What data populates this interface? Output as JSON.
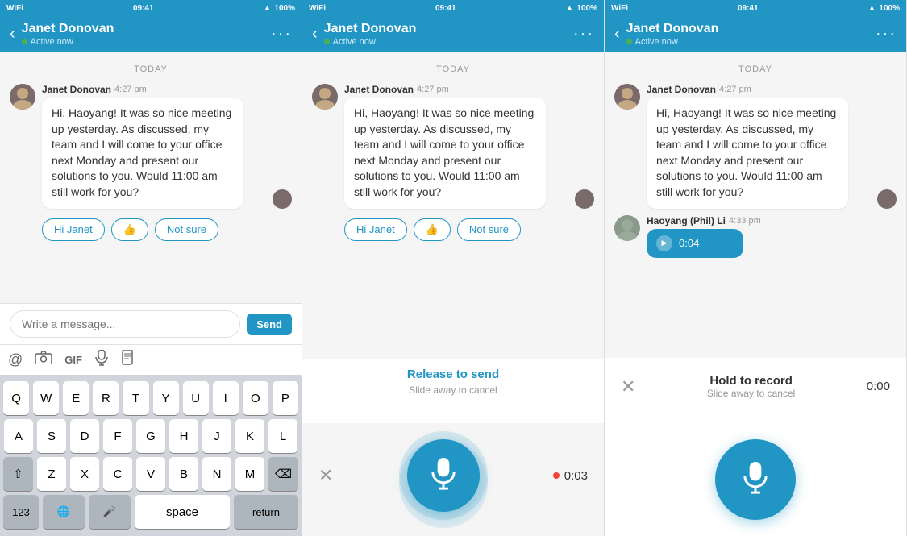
{
  "colors": {
    "primary": "#2196c4",
    "active_green": "#4caf50",
    "bg_light": "#f5f5f5",
    "text_dark": "#333",
    "text_mid": "#666",
    "text_light": "#999"
  },
  "panels": [
    {
      "id": "panel1",
      "status_bar": {
        "time": "09:41",
        "signal": "WiFi",
        "battery": "100%"
      },
      "header": {
        "name": "Janet Donovan",
        "status": "Active now",
        "back_label": "‹",
        "dots_label": "···"
      },
      "date_label": "TODAY",
      "messages": [
        {
          "sender": "Janet Donovan",
          "time": "4:27 pm",
          "text": "Hi, Haoyang! It was so nice meeting up yesterday. As discussed, my team and I will come to your office next Monday and present our solutions to you. Would 11:00 am still work for you?"
        }
      ],
      "quick_replies": [
        "Hi Janet",
        "👍",
        "Not sure"
      ],
      "input_placeholder": "Write a message...",
      "send_label": "Send",
      "toolbar_icons": [
        "@",
        "📷",
        "GIF",
        "🎤",
        "📄"
      ]
    },
    {
      "id": "panel2",
      "status_bar": {
        "time": "09:41",
        "signal": "WiFi",
        "battery": "100%"
      },
      "header": {
        "name": "Janet Donovan",
        "status": "Active now",
        "back_label": "‹",
        "dots_label": "···"
      },
      "date_label": "TODAY",
      "messages": [
        {
          "sender": "Janet Donovan",
          "time": "4:27 pm",
          "text": "Hi, Haoyang! It was so nice meeting up yesterday. As discussed, my team and I will come to your office next Monday and present our solutions to you. Would 11:00 am still work for you?"
        }
      ],
      "quick_replies": [
        "Hi Janet",
        "👍",
        "Not sure"
      ],
      "recording": {
        "status_label": "Release to send",
        "sub_label": "Slide away to cancel",
        "timer": "0:03",
        "cancel_icon": "✕"
      }
    },
    {
      "id": "panel3",
      "status_bar": {
        "time": "09:41",
        "signal": "WiFi",
        "battery": "100%"
      },
      "header": {
        "name": "Janet Donovan",
        "status": "Active now",
        "back_label": "‹",
        "dots_label": "···"
      },
      "date_label": "TODAY",
      "messages": [
        {
          "sender": "Janet Donovan",
          "time": "4:27 pm",
          "text": "Hi, Haoyang! It was so nice meeting up yesterday. As discussed, my team and I will come to your office next Monday and present our solutions to you. Would 11:00 am still work for you?"
        },
        {
          "sender": "Haoyang (Phil) Li",
          "time": "4:33 pm",
          "type": "audio",
          "duration": "0:04"
        }
      ],
      "hold": {
        "title": "Hold to record",
        "sub_label": "Slide away to cancel",
        "timer": "0:00",
        "cancel_icon": "✕"
      }
    }
  ],
  "keyboard": {
    "rows": [
      [
        "Q",
        "W",
        "E",
        "R",
        "T",
        "Y",
        "U",
        "I",
        "O",
        "P"
      ],
      [
        "A",
        "S",
        "D",
        "F",
        "G",
        "H",
        "J",
        "K",
        "L"
      ],
      [
        "⇧",
        "Z",
        "X",
        "C",
        "V",
        "B",
        "N",
        "M",
        "⌫"
      ],
      [
        "123",
        "🌐",
        "🎤",
        "space",
        "return"
      ]
    ]
  }
}
